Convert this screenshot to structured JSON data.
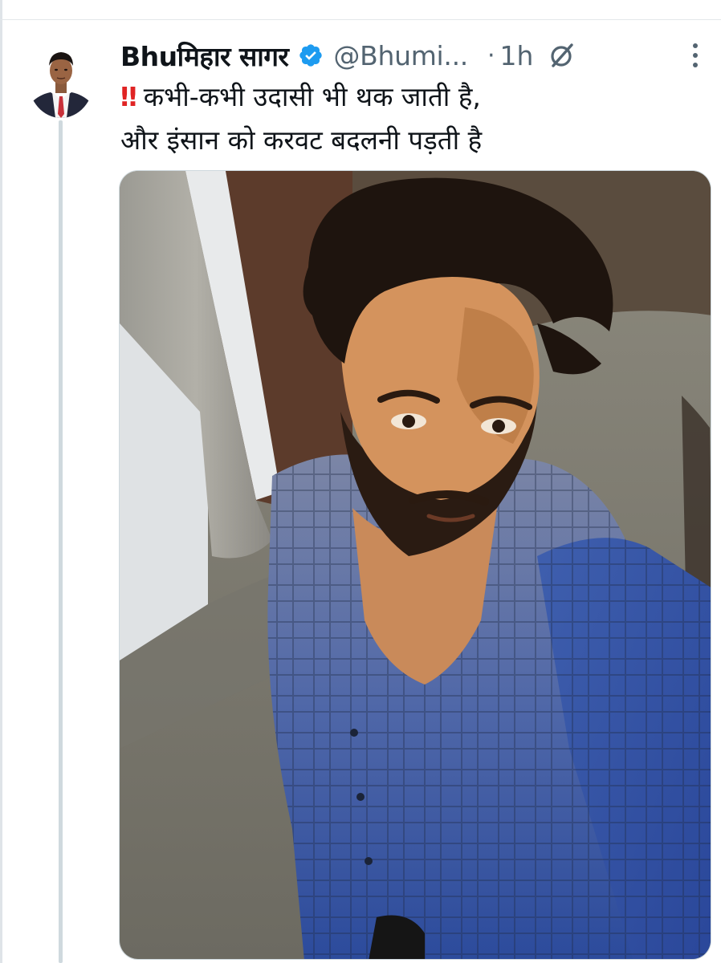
{
  "tweet": {
    "display_name": "Bhuमिहार सागर",
    "handle": "@Bhumi...",
    "separator": "·",
    "time": "1h",
    "text_prefix_emoji": "‼",
    "text_line_1": "कभी-कभी उदासी भी थक जाती है,",
    "text_line_2": "और इंसान को करवट बदलनी पड़ती है"
  },
  "icons": {
    "verified": "verified-badge-icon",
    "grok": "grok-icon",
    "more": "more-options-icon"
  },
  "colors": {
    "verified": "#1d9bf0",
    "name": "#0f1419",
    "secondary": "#536471",
    "emoji": "#e02424",
    "thread_line": "#cfd9de"
  }
}
